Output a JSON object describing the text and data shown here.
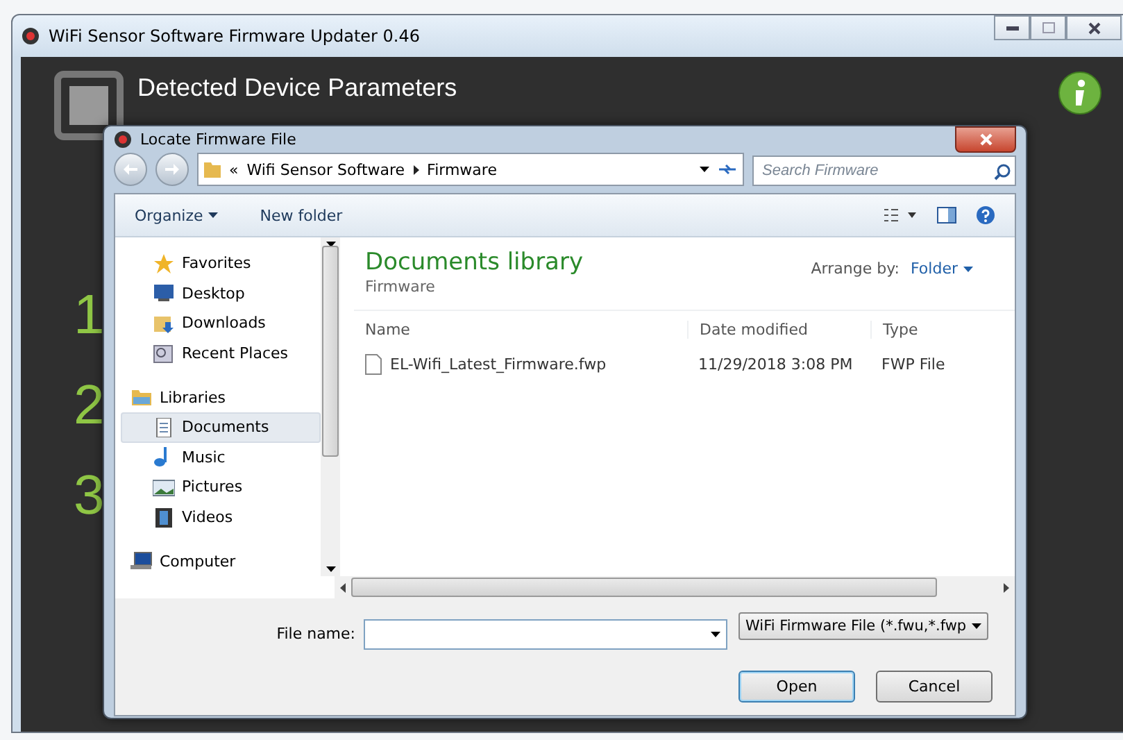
{
  "window": {
    "title": "WiFi Sensor Software Firmware Updater 0.46"
  },
  "app": {
    "heading": "Detected Device Parameters",
    "steps": [
      "1",
      "2",
      "3"
    ]
  },
  "dialog": {
    "title": "Locate Firmware File",
    "breadcrumb": {
      "overflow": "«",
      "parts": [
        "Wifi Sensor Software",
        "Firmware"
      ]
    },
    "search": {
      "placeholder": "Search Firmware"
    },
    "toolbar": [
      {
        "label": "Organize",
        "dropdown": true
      },
      {
        "label": "New folder",
        "dropdown": false
      }
    ],
    "nav": [
      {
        "label": "Favorites",
        "kind": "star",
        "children": [
          {
            "label": "Desktop",
            "kind": "desktop",
            "selected": false
          },
          {
            "label": "Downloads",
            "kind": "downloads",
            "selected": false
          },
          {
            "label": "Recent Places",
            "kind": "recent",
            "selected": false
          }
        ]
      },
      {
        "label": "Libraries",
        "kind": "library",
        "children": [
          {
            "label": "Documents",
            "kind": "documents",
            "selected": true
          },
          {
            "label": "Music",
            "kind": "music",
            "selected": false
          },
          {
            "label": "Pictures",
            "kind": "pictures",
            "selected": false
          },
          {
            "label": "Videos",
            "kind": "videos",
            "selected": false
          }
        ]
      },
      {
        "label": "Computer",
        "kind": "computer"
      }
    ],
    "library": {
      "title": "Documents library",
      "subtitle": "Firmware",
      "arrange_label": "Arrange by:",
      "arrange_value": "Folder"
    },
    "columns": [
      "Name",
      "Date modified",
      "Type"
    ],
    "rows": [
      {
        "name": "EL-Wifi_Latest_Firmware.fwp",
        "date": "11/29/2018 3:08 PM",
        "type": "FWP File"
      }
    ],
    "file_name_label": "File name:",
    "file_type": "WiFi Firmware File (*.fwu,*.fwp",
    "buttons": [
      {
        "label": "Open",
        "default": true
      },
      {
        "label": "Cancel",
        "default": false
      }
    ]
  }
}
